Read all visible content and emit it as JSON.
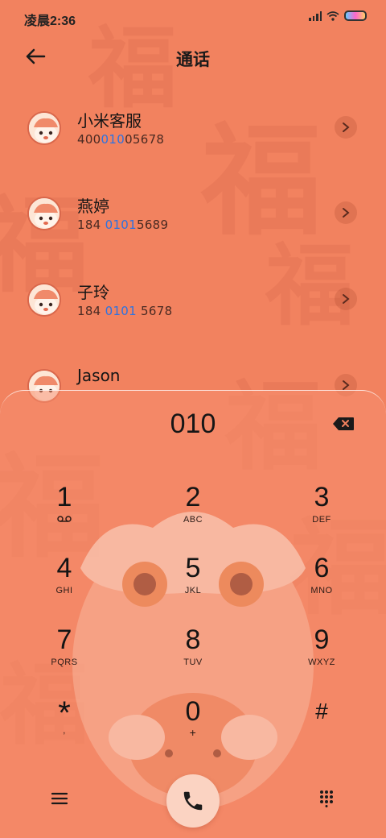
{
  "status_bar": {
    "time": "凌晨2:36",
    "icons": [
      "signal-icon",
      "wifi-icon",
      "battery-icon"
    ]
  },
  "header": {
    "title": "通话",
    "back_icon": "arrow-left-icon"
  },
  "contacts": [
    {
      "name": "小米客服",
      "number_pre": "400",
      "number_match": "010",
      "number_post": "05678"
    },
    {
      "name": "燕婷",
      "number_pre": "184 ",
      "number_match": "0101",
      "number_post": "5689"
    },
    {
      "name": "子玲",
      "number_pre": "184 ",
      "number_match": "0101",
      "number_post": " 5678"
    },
    {
      "name": "Jason",
      "number_pre": "",
      "number_match": "",
      "number_post": ""
    }
  ],
  "dialer": {
    "display": "010",
    "keys": [
      {
        "digit": "1",
        "letters": "ᴑᴑ"
      },
      {
        "digit": "2",
        "letters": "ABC"
      },
      {
        "digit": "3",
        "letters": "DEF"
      },
      {
        "digit": "4",
        "letters": "GHI"
      },
      {
        "digit": "5",
        "letters": "JKL"
      },
      {
        "digit": "6",
        "letters": "MNO"
      },
      {
        "digit": "7",
        "letters": "PQRS"
      },
      {
        "digit": "8",
        "letters": "TUV"
      },
      {
        "digit": "9",
        "letters": "WXYZ"
      },
      {
        "digit": "*",
        "letters": ","
      },
      {
        "digit": "0",
        "letters": "+"
      },
      {
        "digit": "#",
        "letters": ""
      }
    ]
  },
  "colors": {
    "background": "#F2825F",
    "highlight": "#2D72E0",
    "call_button": "#FBD3C2"
  }
}
